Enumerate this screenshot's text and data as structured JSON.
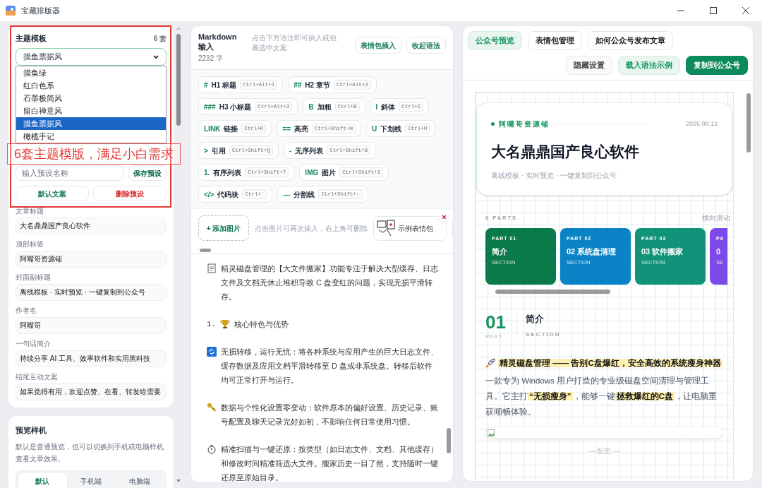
{
  "window": {
    "title": "宝藏排版器"
  },
  "annotation": {
    "text": "6套主题模版，满足小白需求"
  },
  "theme_card": {
    "title": "主题模板",
    "count": "6 套",
    "select_value": "摸鱼票据风",
    "options": [
      {
        "label": "摸鱼绿",
        "selected": false
      },
      {
        "label": "红白色系",
        "selected": false
      },
      {
        "label": "石墨极简风",
        "selected": false
      },
      {
        "label": "留白禅意风",
        "selected": false
      },
      {
        "label": "摸鱼票据风",
        "selected": true
      },
      {
        "label": "橄榄手记",
        "selected": false
      }
    ],
    "preset_placeholder": "输入预设名称",
    "save_button": "保存预设",
    "buttons": [
      {
        "label": "默认文案",
        "kind": "default"
      },
      {
        "label": "删除预设",
        "kind": "danger"
      }
    ]
  },
  "fields": [
    {
      "label": "文章标题",
      "value": "大名鼎鼎国产良心软件"
    },
    {
      "label": "顶部标签",
      "value": "阿嘴哥资源铺"
    },
    {
      "label": "封面副标题",
      "value": "离线模板 · 实时预览 · 一键复制到公众号"
    },
    {
      "label": "作者名",
      "value": "阿嘴哥"
    },
    {
      "label": "一句话简介",
      "value": "持续分享 AI 工具、效率软件和实用黑科技"
    },
    {
      "label": "结尾互动文案",
      "value": "如果觉得有用，欢迎点赞、在看、转发给需要"
    }
  ],
  "device_card": {
    "title": "预览样机",
    "description": "默认是普通预览，也可以切换到手机或电脑样机查看文章效果。",
    "segments": [
      {
        "label": "默认",
        "selected": true
      },
      {
        "label": "手机端",
        "selected": false
      },
      {
        "label": "电脑端",
        "selected": false
      }
    ]
  },
  "editor": {
    "title": "Markdown 输入",
    "count": "2232 字",
    "hint": "点击下方语法即可插入或包裹选中文案",
    "buttons": [
      "表情包插入",
      "收起语法"
    ],
    "syntax_rows": [
      [
        {
          "mark": "#",
          "label": "H1 标题",
          "shortcut": "Ctrl+Alt+1"
        },
        {
          "mark": "##",
          "label": "H2 章节",
          "shortcut": "Ctrl+Alt+2"
        }
      ],
      [
        {
          "mark": "###",
          "label": "H3 小标题",
          "shortcut": "Ctrl+Alt+3"
        },
        {
          "mark": "B",
          "label": "加粗",
          "shortcut": "Ctrl+B"
        },
        {
          "mark": "I",
          "label": "斜体",
          "shortcut": "Ctrl+I"
        }
      ],
      [
        {
          "mark": "LINK",
          "label": "链接",
          "shortcut": "Ctrl+K"
        },
        {
          "mark": "==",
          "label": "高亮",
          "shortcut": "Ctrl+Shift+H"
        },
        {
          "mark": "U",
          "label": "下划线",
          "shortcut": "Ctrl+U"
        }
      ],
      [
        {
          "mark": ">",
          "label": "引用",
          "shortcut": "Ctrl+Shift+Q"
        },
        {
          "mark": "-",
          "label": "无序列表",
          "shortcut": "Ctrl+Shift+8"
        }
      ],
      [
        {
          "mark": "1.",
          "label": "有序列表",
          "shortcut": "Ctrl+Shift+7"
        },
        {
          "mark": "IMG",
          "label": "图片",
          "shortcut": "Ctrl+Shift+I"
        }
      ],
      [
        {
          "mark": "</>",
          "label": "代码块",
          "shortcut": "Ctrl+`"
        },
        {
          "mark": "---",
          "label": "分割线",
          "shortcut": "Ctrl+Shift+-"
        }
      ]
    ],
    "add_image": "+ 添加图片",
    "image_hint": "点击图片可再次插入，右上角可删除",
    "stickers": [
      {
        "label": "示例表情包"
      }
    ],
    "paragraphs": [
      {
        "kind": "note",
        "text": "精灵磁盘管理的【大文件搬家】功能专注于解决大型缓存、日志文件及文档无休止堆积导致 C 盘变红的问题，实现无损平滑转存。"
      },
      {
        "kind": "heading",
        "prefix": "1.",
        "text": "核心特色与优势"
      },
      {
        "kind": "transfer",
        "text": "无损转移，运行无忧：将各种系统与应用产生的巨大日志文件、缓存数据及应用文档平滑转移至 D 盘或非系统盘。转移后软件均可正常打开与运行。"
      },
      {
        "kind": "settings",
        "text": "数据与个性化设置零变动：软件原本的偏好设置、历史记录、账号配置及聊天记录完好如初，不影响任何日常使用习惯。"
      },
      {
        "kind": "scan",
        "text": "精准扫描与一键还原：按类型（如日志文件、文档、其他缓存）和修改时间精准筛选大文件。搬家历史一目了然，支持随时一键还原至原始目录。"
      }
    ]
  },
  "preview": {
    "tabs": [
      {
        "label": "公众号预览",
        "selected": true
      },
      {
        "label": "表情包管理",
        "selected": false
      },
      {
        "label": "如何公众号发布文章",
        "selected": false
      }
    ],
    "actions": [
      {
        "label": "隐藏设置",
        "kind": "plain"
      },
      {
        "label": "载入语法示例",
        "kind": "soft"
      },
      {
        "label": "复制到公众号",
        "kind": "primary"
      }
    ],
    "cover": {
      "tag": "阿嘴哥资源铺",
      "date": "2026.08.12",
      "title": "大名鼎鼎国产良心软件",
      "subtitle": "离线模板 · 实时预览 · 一键复制到公众号"
    },
    "parts_label": "6 PARTS",
    "parts_hint": "横向滑动",
    "parts": [
      {
        "part": "PART 01",
        "title": "简介",
        "section": "SECTION",
        "color": "#0b7a4b"
      },
      {
        "part": "PART 02",
        "title": "02 系统盘清理",
        "section": "SECTION",
        "color": "#0a84c6"
      },
      {
        "part": "PART 03",
        "title": "03 软件搬家",
        "section": "SECTION",
        "color": "#11937a"
      },
      {
        "part": "PA",
        "title": "0",
        "section": "SE",
        "color": "#7c4ae8"
      }
    ],
    "section": {
      "number": "01",
      "part": "PART",
      "title": "简介",
      "subtitle": "SECTION"
    },
    "lead": [
      {
        "text": "精灵磁盘管理 —— 告别C盘爆红，安全高效的系统瘦身神器",
        "highlight": true
      }
    ],
    "body": [
      {
        "text": "一款专为 Windows 用户打造的专业级磁盘空间清理与管理工具。它主打",
        "highlight": false
      },
      {
        "text": "“无损瘦身”",
        "highlight": true
      },
      {
        "text": "，能够一键",
        "highlight": false
      },
      {
        "text": "拯救爆红的C盘",
        "highlight": true
      },
      {
        "text": "，让电脑重获顺畅体验。",
        "highlight": false
      }
    ],
    "caption": "— 配图 —"
  }
}
